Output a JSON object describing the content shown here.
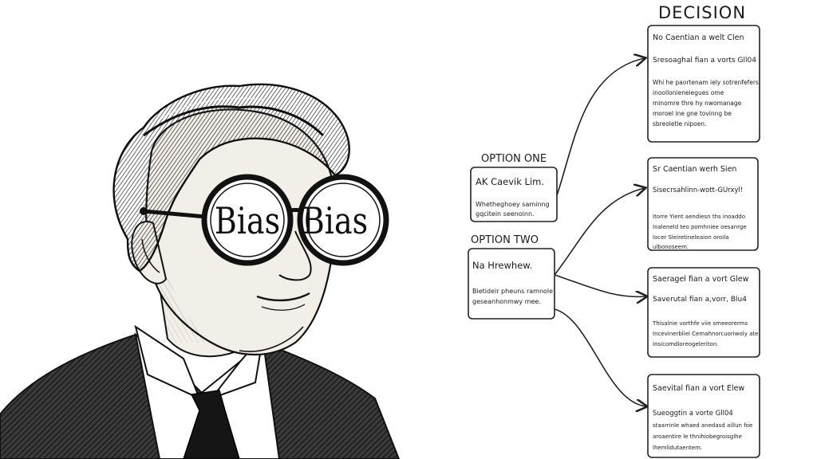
{
  "illustration": {
    "lens_left_text": "Bias",
    "lens_right_text": "Bias"
  },
  "diagram": {
    "heading": "DECISION",
    "options": [
      {
        "label": "OPTION ONE",
        "box_title": "AK Caevik Lim.",
        "box_lines": [
          "Whetheghoey saminng",
          "gqcitein seenoinn."
        ]
      },
      {
        "label": "OPTION TWO",
        "box_title": "Na Hrewhew.",
        "box_lines": [
          "Bietideir pheuns ramnole",
          "geseanhonmwy mee."
        ]
      }
    ],
    "outcomes": [
      {
        "title": "No Caentian a welt Clen",
        "subtitle": "Sresoaghal fian a vorts Gll04",
        "lines": [
          "Whi he paortenam iely sotrenfefers.",
          "inoollonieneiegues ome",
          "minomre thre hy nwomanage",
          "moroel ine gne tovinng be",
          "sbreoletle nipoen."
        ]
      },
      {
        "title": "Sr Caentian werh Sien",
        "subtitle": "Sisecrsahlinn-wott-GUrxyl!",
        "lines": [
          "Itorre Yient aendiesn ths inoaddo",
          "Inaleneld teo pomhniee oesanrge",
          "locer Sleiretineleaion oroila",
          "ulbonoseem."
        ]
      },
      {
        "title": "Saeragel fian a vort Glew",
        "subtitle": "Saverutal fian a,vorr, Blu4",
        "lines": [
          "Thisalnie vorthfe viie smeeorerms",
          "Incevinerbliel Cemahnorcuoriwoly ate",
          "Insicomdloreogeleriton."
        ]
      },
      {
        "title": "Saevital fian a vort Elew",
        "subtitle": "Sueoggtin a vorte Gll04",
        "lines": [
          "staarrinle whaed anedasd aillun foe",
          "aroaentire le thnihiobegroisglhe",
          "lhemlidutaentem."
        ]
      }
    ]
  },
  "colors": {
    "background": "#ffffff",
    "ink": "#1b1b1b",
    "skin": "#f2efe8",
    "lens": "#ffffff"
  }
}
